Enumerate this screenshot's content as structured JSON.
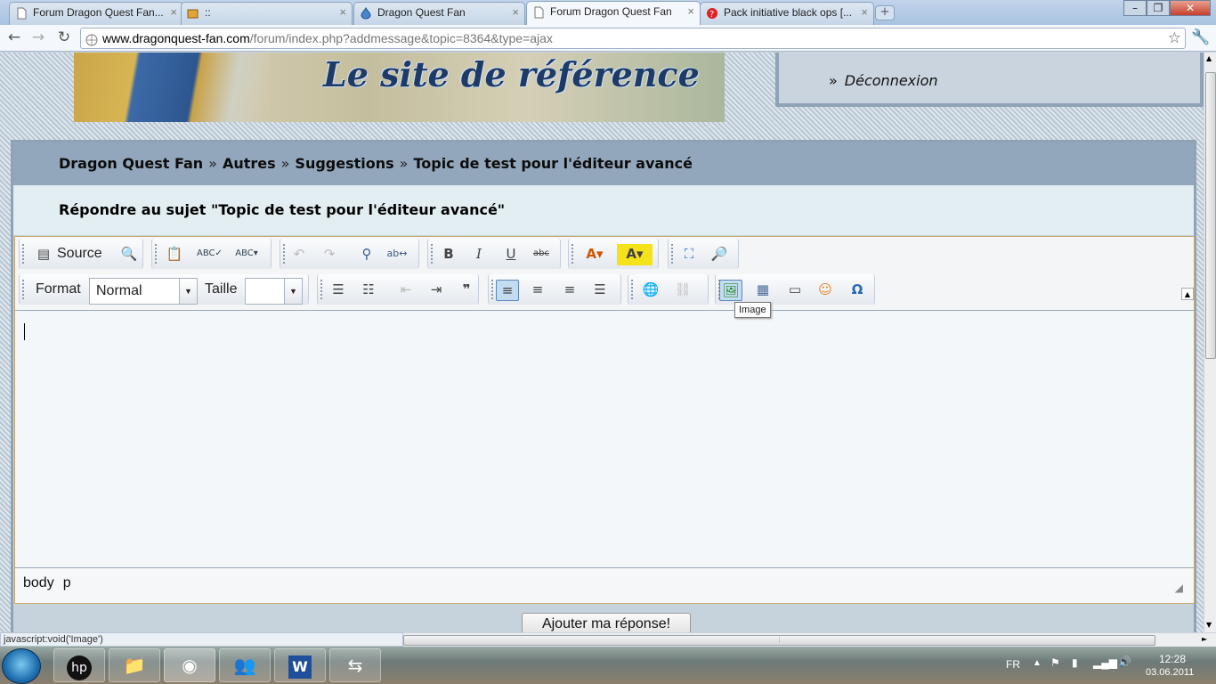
{
  "browser": {
    "tabs": [
      {
        "label": "Forum Dragon Quest Fan...",
        "icon": "page-icon"
      },
      {
        "label": "::",
        "icon": "puzzle-icon"
      },
      {
        "label": "Dragon Quest Fan",
        "icon": "slime-icon"
      },
      {
        "label": "Forum Dragon Quest Fan",
        "icon": "page-icon"
      },
      {
        "label": "Pack initiative black ops [...",
        "icon": "help-icon"
      }
    ],
    "url_domain": "www.dragonquest-fan.com",
    "url_path": "/forum/index.php?addmessage&topic=8364&type=ajax"
  },
  "site": {
    "banner_title": "Le site de référence",
    "user_link": "Déconnexion"
  },
  "breadcrumb": {
    "items": [
      "Dragon Quest Fan",
      "Autres",
      "Suggestions",
      "Topic de test pour l'éditeur avancé"
    ],
    "sep": "»"
  },
  "reply_heading": "Répondre au sujet \"Topic de test pour l'éditeur avancé\"",
  "editor": {
    "source_label": "Source",
    "format_label": "Format",
    "format_value": "Normal",
    "size_label": "Taille",
    "size_value": "",
    "tooltip": "Image",
    "path": [
      "body",
      "p"
    ]
  },
  "submit_label": "Ajouter ma réponse!",
  "status_text": "javascript:void('Image')",
  "taskbar": {
    "lang": "FR",
    "time": "12:28",
    "date": "03.06.2011"
  }
}
